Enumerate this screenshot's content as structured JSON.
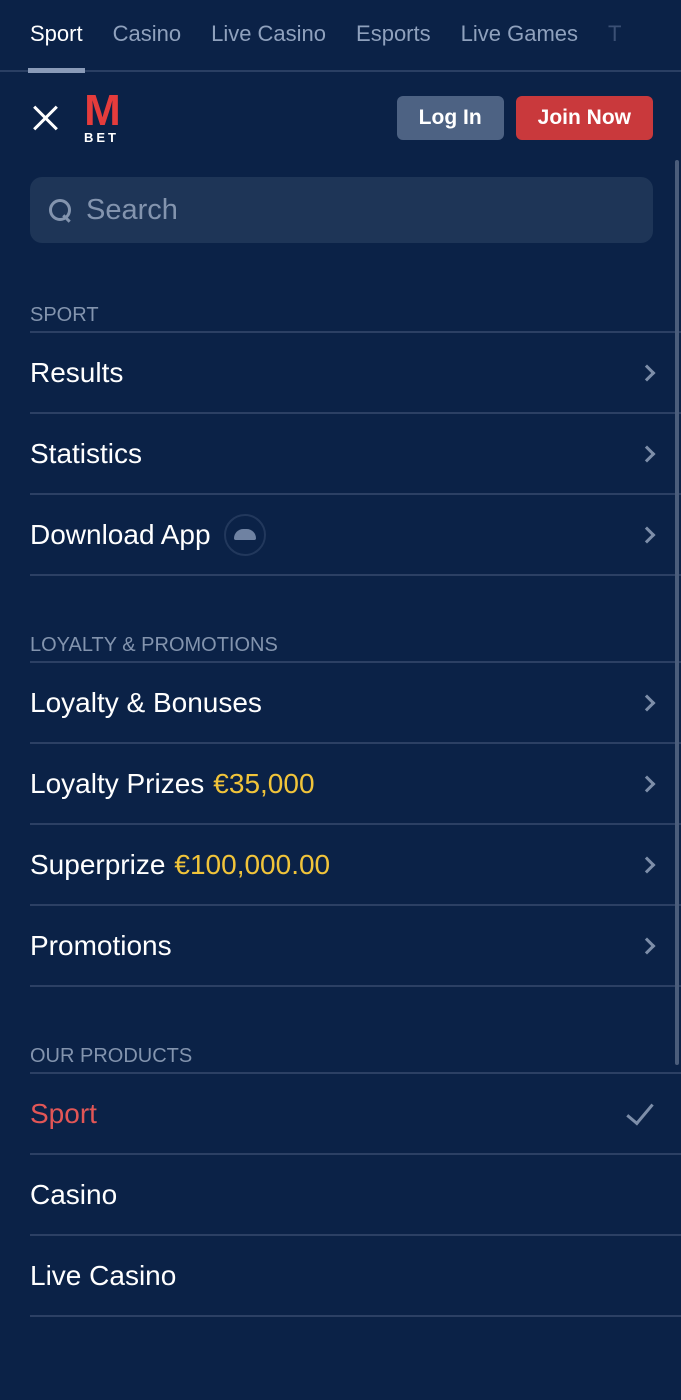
{
  "tabs": [
    {
      "label": "Sport",
      "active": true
    },
    {
      "label": "Casino"
    },
    {
      "label": "Live Casino"
    },
    {
      "label": "Esports"
    },
    {
      "label": "Live Games"
    },
    {
      "label": "T"
    }
  ],
  "header": {
    "logo_m": "M",
    "logo_bet": "BET",
    "login": "Log In",
    "join": "Join Now"
  },
  "search": {
    "placeholder": "Search"
  },
  "sections": [
    {
      "title": "SPORT",
      "items": [
        {
          "label": "Results"
        },
        {
          "label": "Statistics"
        },
        {
          "label": "Download App",
          "icon": "android-icon"
        }
      ]
    },
    {
      "title": "LOYALTY & PROMOTIONS",
      "items": [
        {
          "label": "Loyalty & Bonuses"
        },
        {
          "label": "Loyalty Prizes",
          "amount": "€35,000"
        },
        {
          "label": "Superprize",
          "amount": "€100,000.00"
        },
        {
          "label": "Promotions"
        }
      ]
    },
    {
      "title": "OUR PRODUCTS",
      "items": [
        {
          "label": "Sport",
          "selected": true
        },
        {
          "label": "Casino"
        },
        {
          "label": "Live Casino"
        }
      ]
    }
  ],
  "colors": {
    "background": "#0b2247",
    "accent_red": "#c9393c",
    "amount_yellow": "#f1c43a",
    "selected_red": "#e25656"
  }
}
